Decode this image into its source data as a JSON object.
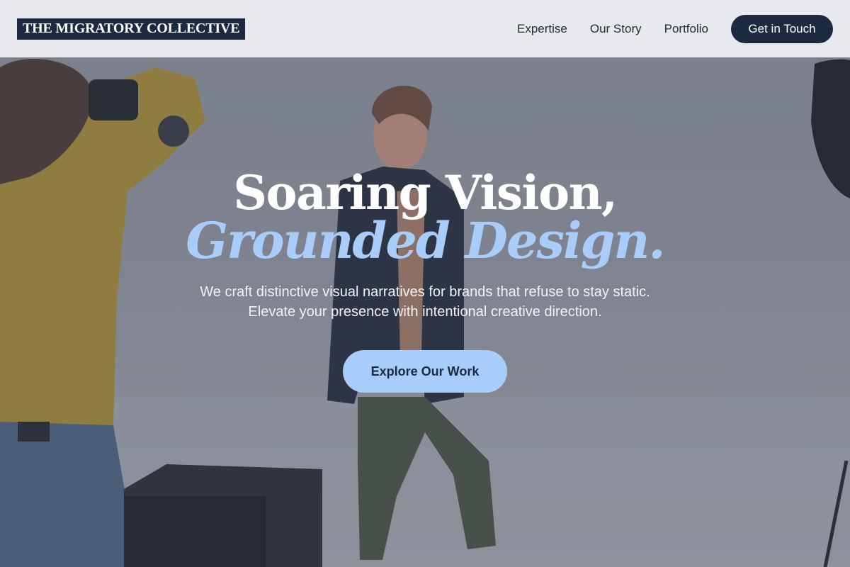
{
  "header": {
    "logo_text": "THE MIGRATORY COLLECTIVE",
    "nav_items": [
      {
        "label": "Expertise"
      },
      {
        "label": "Our Story"
      },
      {
        "label": "Portfolio"
      }
    ],
    "cta_label": "Get in Touch"
  },
  "hero": {
    "headline_line1": "Soaring Vision,",
    "headline_line2": "Grounded Design.",
    "subtext_line1": "We craft distinctive visual narratives for brands that refuse to stay static.",
    "subtext_line2": "Elevate your presence with intentional creative direction.",
    "button_label": "Explore Our Work"
  },
  "colors": {
    "navy": "#1c2a40",
    "accent_blue": "#a9cdfb",
    "header_bg": "#ecedef"
  }
}
